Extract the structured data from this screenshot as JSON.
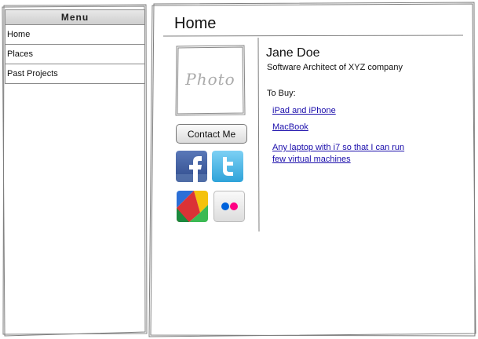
{
  "menu": {
    "title": "Menu",
    "items": [
      {
        "label": "Home"
      },
      {
        "label": "Places"
      },
      {
        "label": "Past Projects"
      }
    ]
  },
  "main": {
    "title": "Home",
    "photo_label": "Photo",
    "contact_button": "Contact Me",
    "social_icons": [
      {
        "name": "facebook-icon",
        "color": "#3b5998"
      },
      {
        "name": "twitter-icon",
        "color": "#4ab3e8"
      },
      {
        "name": "google-icon",
        "color": "#e8e8e8"
      },
      {
        "name": "flickr-icon",
        "color": "#eeeeee"
      }
    ],
    "profile": {
      "name": "Jane Doe",
      "job": "Software Architect of XYZ company"
    },
    "to_buy": {
      "heading": "To Buy:",
      "items": [
        {
          "label": "iPad and iPhone"
        },
        {
          "label": "MacBook"
        },
        {
          "label": "Any laptop with i7 so that I can run few virtual machines"
        }
      ]
    }
  },
  "colors": {
    "link": "#1a0dab",
    "frame": "#7a7a7a"
  }
}
